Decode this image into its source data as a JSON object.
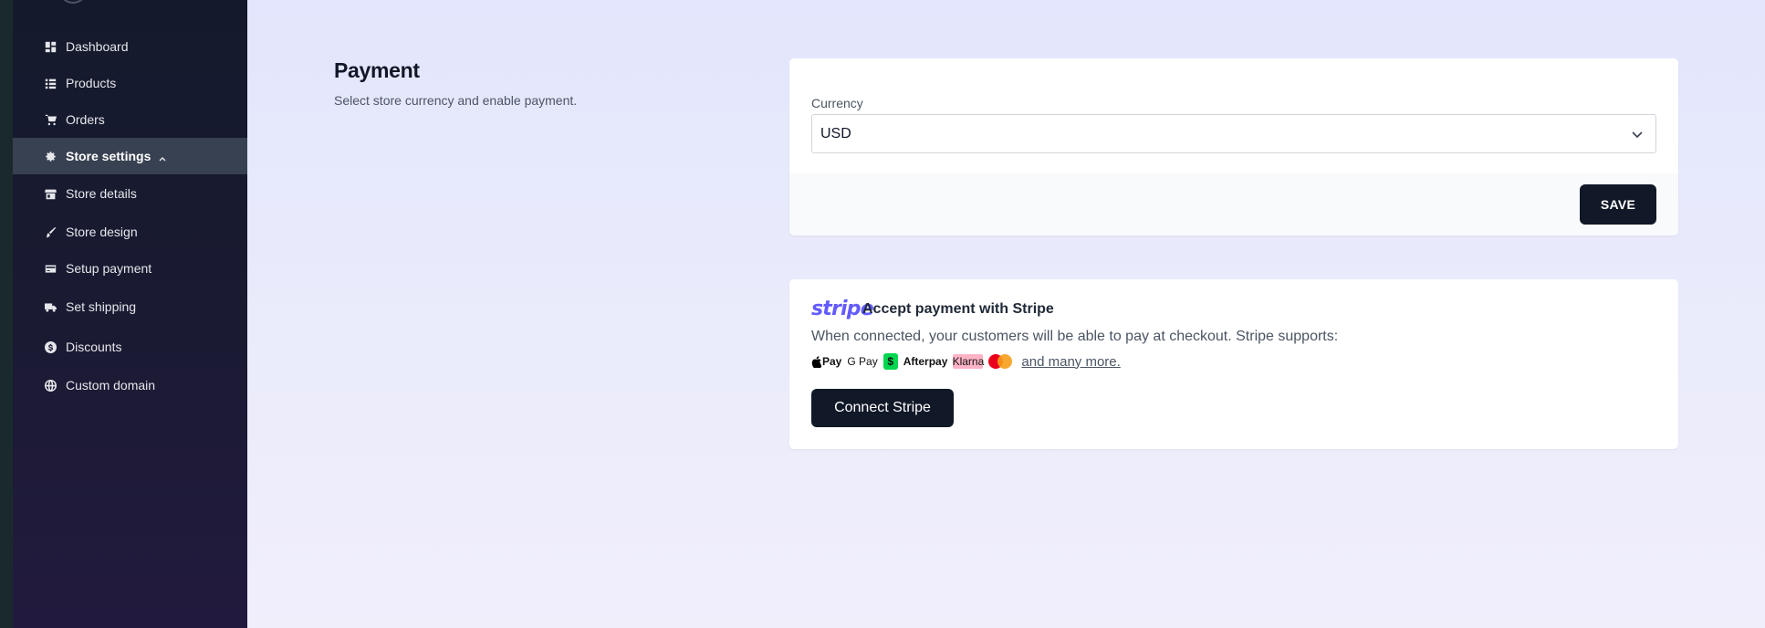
{
  "sidebar": {
    "items": [
      {
        "label": "Dashboard",
        "icon": "dashboard-icon"
      },
      {
        "label": "Products",
        "icon": "list-icon"
      },
      {
        "label": "Orders",
        "icon": "cart-icon"
      },
      {
        "label": "Store settings",
        "icon": "gear-icon",
        "active": true,
        "expanded": true
      },
      {
        "label": "Store details",
        "icon": "store-icon"
      },
      {
        "label": "Store design",
        "icon": "brush-icon"
      },
      {
        "label": "Setup payment",
        "icon": "credit-card-icon"
      },
      {
        "label": "Set shipping",
        "icon": "truck-icon"
      },
      {
        "label": "Discounts",
        "icon": "discount-icon"
      },
      {
        "label": "Custom domain",
        "icon": "globe-icon"
      }
    ]
  },
  "page": {
    "title": "Payment",
    "subtitle": "Select store currency and enable payment."
  },
  "currency_card": {
    "label": "Currency",
    "selected": "USD",
    "save_label": "SAVE"
  },
  "stripe_card": {
    "logo": "stripe",
    "title": "Accept payment with Stripe",
    "description": "When connected, your customers will be able to pay at checkout. Stripe supports:",
    "methods": {
      "apple_pay": "Pay",
      "google_pay": "G Pay",
      "cash_app": "$",
      "afterpay": "Afterpay",
      "klarna": "Klarna"
    },
    "more_link": "and many more.",
    "connect_label": "Connect Stripe"
  },
  "colors": {
    "sidebar_bg": "#161b30",
    "active_item_bg": "#374151",
    "button_bg": "#111827",
    "stripe_brand": "#635bff",
    "page_bg": "#e5e7fc"
  }
}
